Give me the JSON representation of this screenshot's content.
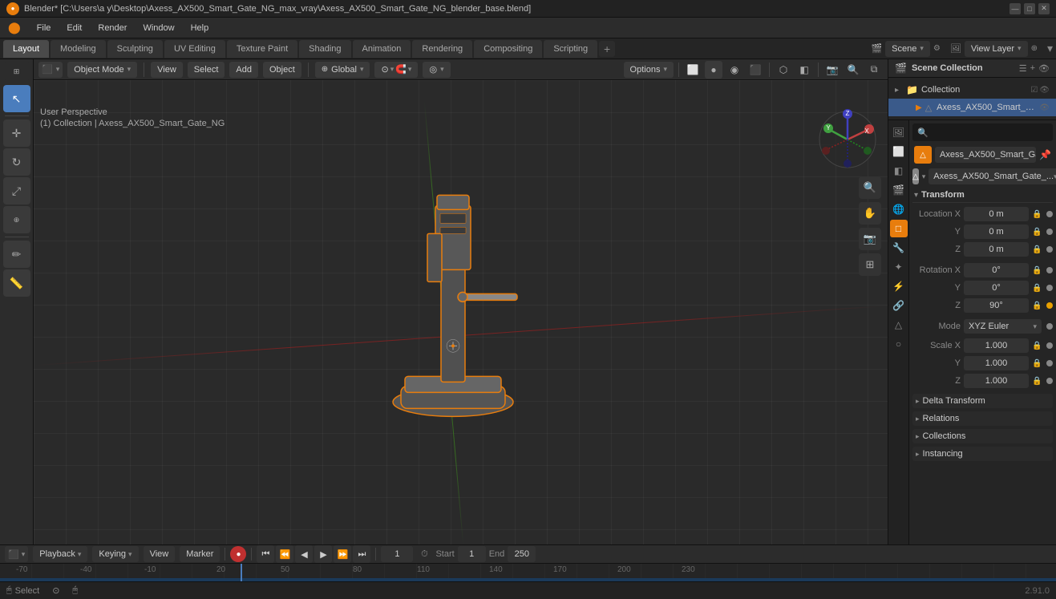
{
  "titlebar": {
    "title": "Blender* [C:\\Users\\a y\\Desktop\\Axess_AX500_Smart_Gate_NG_max_vray\\Axess_AX500_Smart_Gate_NG_blender_base.blend]",
    "controls": [
      "—",
      "□",
      "✕"
    ]
  },
  "menubar": {
    "items": [
      "Blender",
      "File",
      "Edit",
      "Render",
      "Window",
      "Help"
    ]
  },
  "workspace_tabs": {
    "tabs": [
      "Layout",
      "Modeling",
      "Sculpting",
      "UV Editing",
      "Texture Paint",
      "Shading",
      "Animation",
      "Rendering",
      "Compositing",
      "Scripting"
    ],
    "active": "Layout",
    "add_label": "+",
    "scene_label": "Scene",
    "view_layer_label": "View Layer"
  },
  "viewport": {
    "header": {
      "mode_label": "Object Mode",
      "view_label": "View",
      "select_label": "Select",
      "add_label": "Add",
      "object_label": "Object",
      "global_label": "Global",
      "options_label": "Options"
    },
    "view_info": {
      "line1": "User Perspective",
      "line2": "(1) Collection | Axess_AX500_Smart_Gate_NG"
    },
    "nav_gizmo": {
      "x_label": "X",
      "y_label": "Y",
      "z_label": "Z"
    }
  },
  "right_panel": {
    "scene_collection": "Scene Collection",
    "collection": "Collection",
    "object_name": "Axess_AX500_Smart_Ga...",
    "object_name_full": "Axess_AX500_Smart_Gate_...",
    "search_placeholder": "🔍"
  },
  "properties": {
    "object_name_display": "Axess_AX500_Smart_Ga...",
    "mesh_name_display": "Axess_AX500_Smart_Gate_...",
    "transform": {
      "title": "Transform",
      "location": {
        "x": "0 m",
        "y": "0 m",
        "z": "0 m"
      },
      "rotation": {
        "x": "0°",
        "y": "0°",
        "z": "90°"
      },
      "rotation_mode": "XYZ Euler",
      "scale": {
        "x": "1.000",
        "y": "1.000",
        "z": "1.000"
      }
    },
    "sections": {
      "delta_transform": "Delta Transform",
      "relations": "Relations",
      "collections": "Collections",
      "instancing": "Instancing"
    }
  },
  "timeline": {
    "playback_label": "Playback",
    "keying_label": "Keying",
    "view_label": "View",
    "marker_label": "Marker",
    "current_frame": "1",
    "start_label": "Start",
    "start_value": "1",
    "end_label": "End",
    "end_value": "250"
  },
  "statusbar": {
    "select_label": "Select",
    "version": "2.91.0"
  }
}
